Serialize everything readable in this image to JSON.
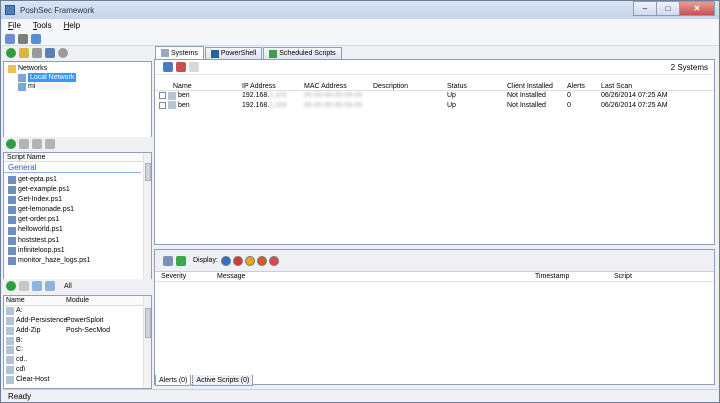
{
  "window": {
    "title": "PoshSec Framework"
  },
  "menu": [
    {
      "label": "File",
      "accel": "F",
      "rest": "ile"
    },
    {
      "label": "Tools",
      "accel": "T",
      "rest": "ools"
    },
    {
      "label": "Help",
      "accel": "H",
      "rest": "elp"
    }
  ],
  "networks": {
    "root": "Networks",
    "selected": "Local Network",
    "child": "mi"
  },
  "scripts": {
    "header": "Script Name",
    "group": "General",
    "items": [
      "get-epta.ps1",
      "get-example.ps1",
      "Get-Index.ps1",
      "get-lemonade.ps1",
      "get-order.ps1",
      "helloworld.ps1",
      "hoststest.ps1",
      "infiniteloop.ps1",
      "monitor_haze_logs.ps1"
    ]
  },
  "commands": {
    "filter": "All",
    "headers": {
      "name": "Name",
      "module": "Module"
    },
    "rows": [
      {
        "name": "A:",
        "module": ""
      },
      {
        "name": "Add-Persistence",
        "module": "PowerSploit"
      },
      {
        "name": "Add-Zip",
        "module": "Posh-SecMod"
      },
      {
        "name": "B:",
        "module": ""
      },
      {
        "name": "C:",
        "module": ""
      },
      {
        "name": "cd..",
        "module": ""
      },
      {
        "name": "cd\\",
        "module": ""
      },
      {
        "name": "Clear-Host",
        "module": ""
      }
    ]
  },
  "tabs": [
    {
      "label": "Systems",
      "active": true
    },
    {
      "label": "PowerShell",
      "active": false
    },
    {
      "label": "Scheduled Scripts",
      "active": false
    }
  ],
  "systems": {
    "count": "2 Systems",
    "headers": {
      "name": "Name",
      "ip": "IP Address",
      "mac": "MAC Address",
      "description": "Description",
      "status": "Status",
      "client": "Client Installed",
      "alerts": "Alerts",
      "last_scan": "Last Scan"
    },
    "rows": [
      {
        "name": "ben",
        "ip": "192.168.",
        "ip_hidden": "1.103",
        "mac": "00-00-00-00-00-00",
        "description": "",
        "status": "Up",
        "client": "Not Installed",
        "alerts": "0",
        "last_scan": "06/26/2014 07:25 AM"
      },
      {
        "name": "ben",
        "ip": "192.168.",
        "ip_hidden": "1.104",
        "mac": "00-00-00-00-00-00",
        "description": "",
        "status": "Up",
        "client": "Not Installed",
        "alerts": "0",
        "last_scan": "06/26/2014 07:25 AM"
      }
    ]
  },
  "alerts": {
    "display_label": "Display:",
    "headers": {
      "severity": "Severity",
      "message": "Message",
      "timestamp": "Timestamp",
      "script": "Script"
    }
  },
  "bottom_tabs": [
    {
      "label": "Alerts (0)",
      "active": true
    },
    {
      "label": "Active Scripts (0)",
      "active": false
    }
  ],
  "status": {
    "text": "Ready"
  },
  "colors": {
    "accent": "#3399ff",
    "border": "#8d9fb8",
    "group": "#2a64c0"
  }
}
